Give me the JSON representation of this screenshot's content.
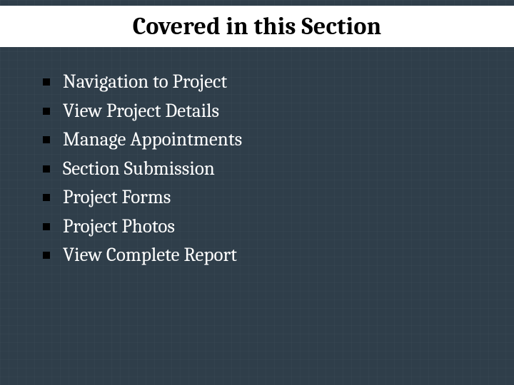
{
  "title": "Covered in this Section",
  "bullets": [
    "Navigation to Project",
    "View Project Details",
    "Manage Appointments",
    "Section Submission",
    "Project Forms",
    "Project Photos",
    "View Complete Report"
  ]
}
